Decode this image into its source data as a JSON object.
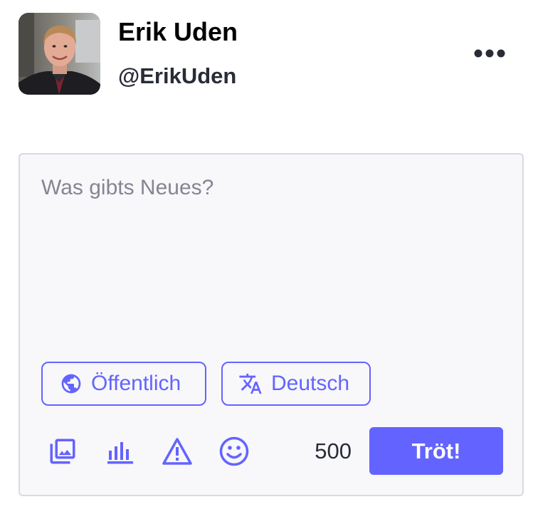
{
  "profile": {
    "display_name": "Erik Uden",
    "handle": "@ErikUden"
  },
  "compose": {
    "placeholder": "Was gibts Neues?",
    "value": "",
    "visibility_label": "Öffentlich",
    "language_label": "Deutsch",
    "char_count": "500",
    "publish_label": "Tröt!"
  },
  "icons": {
    "avatar": "user-photo",
    "more": "more-horizontal-icon",
    "visibility": "globe-icon",
    "language": "translate-icon",
    "media": "add-media-icon",
    "poll": "poll-icon",
    "content_warning": "warning-icon",
    "emoji": "emoji-icon"
  },
  "colors": {
    "accent": "#6364ff",
    "composer_bg": "#f8f7fa",
    "composer_border": "#d9d9e3",
    "placeholder": "#858593",
    "text": "#282c37"
  }
}
